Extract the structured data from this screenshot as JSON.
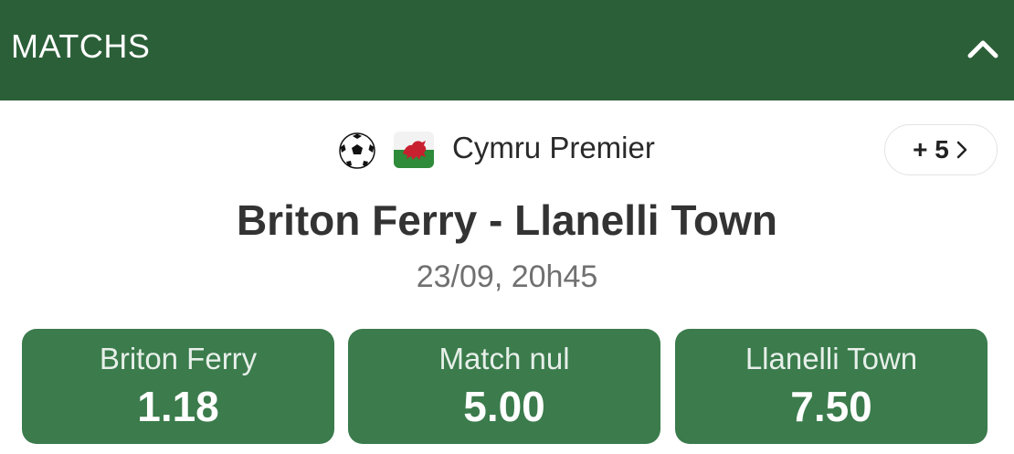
{
  "header": {
    "title": "MATCHS",
    "collapse_icon": "chevron-up-icon"
  },
  "league": {
    "sport_icon": "soccer-ball-icon",
    "flag_icon": "wales-flag-icon",
    "name": "Cymru Premier",
    "more_label": "+ 5",
    "more_icon": "chevron-right-icon"
  },
  "match": {
    "title": "Briton Ferry - Llanelli Town",
    "datetime": "23/09, 20h45"
  },
  "odds": [
    {
      "label": "Briton Ferry",
      "value": "1.18"
    },
    {
      "label": "Match nul",
      "value": "5.00"
    },
    {
      "label": "Llanelli Town",
      "value": "7.50"
    }
  ],
  "colors": {
    "header_bg": "#2b5f38",
    "odds_bg": "#3b7b4c",
    "text_dark": "#333333",
    "text_muted": "#707070"
  }
}
